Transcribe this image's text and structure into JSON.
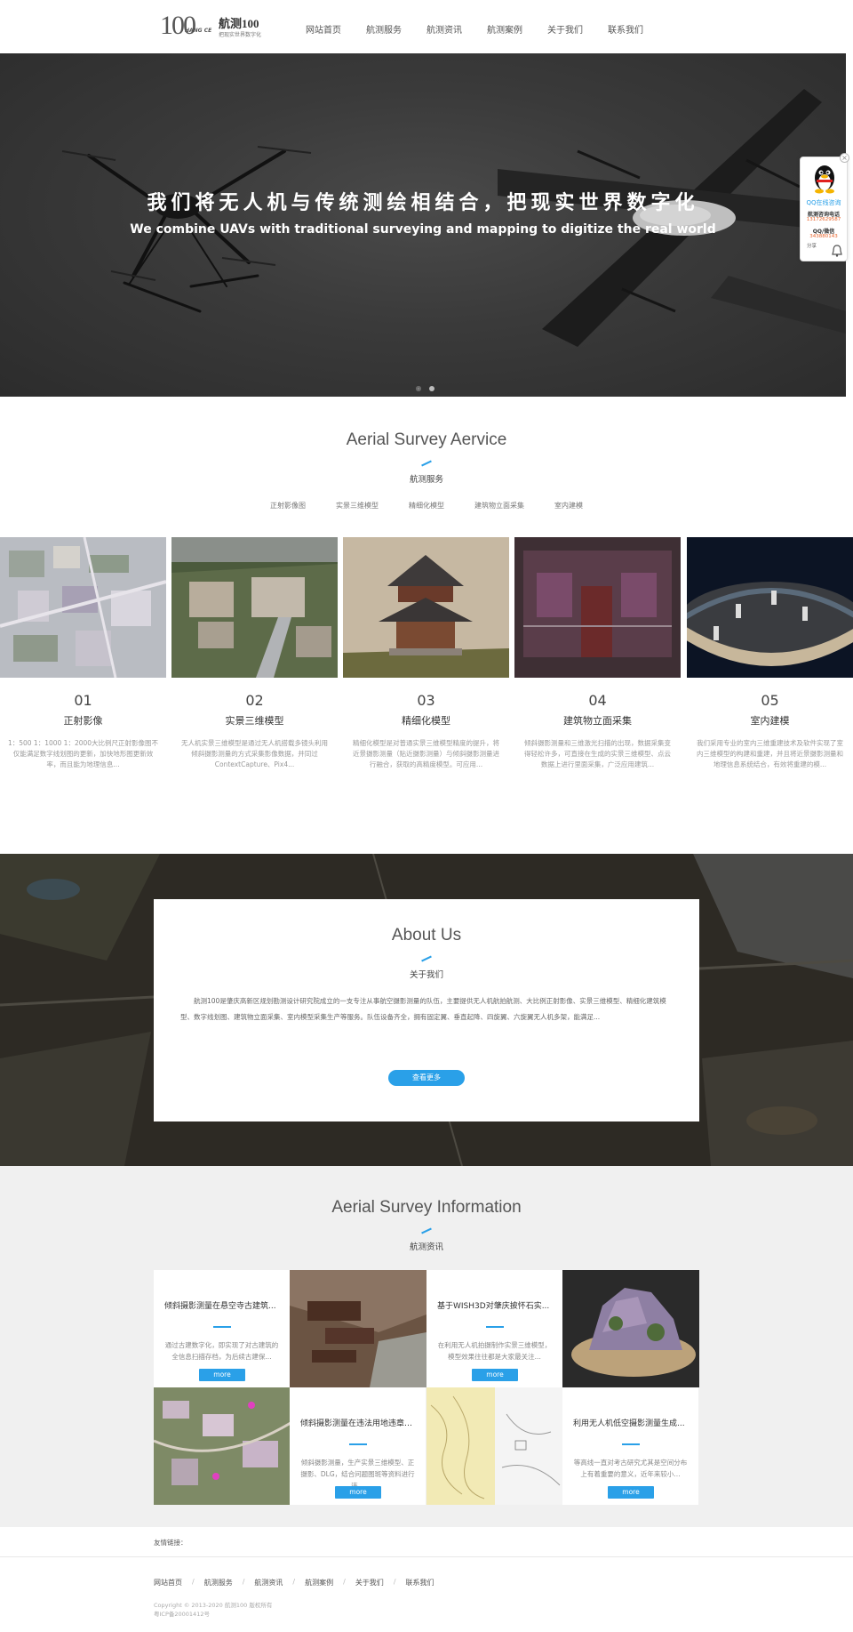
{
  "header": {
    "logo": {
      "number": "100",
      "mark": "HANG CE",
      "name": "航测100",
      "slogan": "把现实世界数字化"
    },
    "nav": [
      "网站首页",
      "航测服务",
      "航测资讯",
      "航测案例",
      "关于我们",
      "联系我们"
    ]
  },
  "banner": {
    "title": "我们将无人机与传统测绘相结合，把现实世界数字化",
    "subtitle": "We combine UAVs with traditional surveying and mapping to digitize the real world"
  },
  "qq_widget": {
    "close": "×",
    "online": "QQ在线咨询",
    "phone_label": "航测咨询电话",
    "phone": "13172629587",
    "qq_label": "QQ/微信",
    "qq": "343880143",
    "share": "分享",
    "icons": [
      "penguin-icon",
      "bell-icon"
    ]
  },
  "services": {
    "title": "Aerial Survey Aervice",
    "subtitle": "航测服务",
    "tabs": [
      "正射影像图",
      "实景三维模型",
      "精细化模型",
      "建筑物立面采集",
      "室内建模"
    ],
    "cards": [
      {
        "num": "01",
        "title": "正射影像",
        "desc": "1：500 1：1000 1：2000大比例尺正射影像图不仅能满足数字线划图的更新，加快地形图更新效率，而且能为地理信息..."
      },
      {
        "num": "02",
        "title": "实景三维模型",
        "desc": "无人机实景三维模型是通过无人机搭载多镜头利用倾斜摄影测量的方式采集影像数据，并同过ContextCapture、Pix4..."
      },
      {
        "num": "03",
        "title": "精细化模型",
        "desc": "精细化模型是对普通实景三维模型精度的提升，将近景摄影测量（贴近摄影测量）与倾斜摄影测量进行融合，获取的高精度模型。可应用..."
      },
      {
        "num": "04",
        "title": "建筑物立面采集",
        "desc": "倾斜摄影测量和三维激光扫描的出现，数据采集变得轻松许多，可直接在生成的实景三维模型、点云数据上进行里面采集，广泛应用建筑..."
      },
      {
        "num": "05",
        "title": "室内建模",
        "desc": "我们采用专业的室内三维重建技术及软件实现了室内三维模型的构建和重建，并且将近景摄影测量和地理信息系统结合，有效将重建的模..."
      }
    ]
  },
  "about": {
    "title": "About Us",
    "subtitle": "关于我们",
    "text": "航测100是肇庆高新区规划勘测设计研究院成立的一支专注从事航空摄影测量的队伍，主要提供无人机航拍航测、大比例正射影像、实景三维模型、精细化建筑模型、数字线划图、建筑物立面采集、室内模型采集生产等服务。队伍设备齐全，拥有固定翼、垂直起降、四旋翼、六旋翼无人机多架，能满足...",
    "button": "查看更多"
  },
  "info": {
    "title": "Aerial Survey Information",
    "subtitle": "航测资讯",
    "articles": [
      {
        "title": "倾斜摄影测量在悬空寺古建筑...",
        "excerpt": "通过古建数字化，即实现了对古建筑的全信息扫描存档，为后续古建保...",
        "button": "more"
      },
      {
        "title": "基于WISH3D对肇庆披怀石实...",
        "excerpt": "在利用无人机拍摄制作实景三维模型，模型效果往往都是大家最关注...",
        "button": "more"
      },
      {
        "title": "倾斜摄影测量在违法用地违章建...",
        "excerpt": "倾斜摄影测量，生产实景三维模型、正摄影、DLG，结合问题图斑等资料进行违...",
        "button": "more"
      },
      {
        "title": "利用无人机低空摄影测量生成...",
        "excerpt": "等高线一直对考古研究尤其是空间分布上有着重要的意义，近年来较小...",
        "button": "more"
      }
    ]
  },
  "friend_links": {
    "label": "友情链接："
  },
  "footer": {
    "nav": [
      "网站首页",
      "航测服务",
      "航测资讯",
      "航测案例",
      "关于我们",
      "联系我们"
    ],
    "separator": "/",
    "copyright": "Copyright © 2013-2020 航测100 版权所有",
    "icp": "粤ICP备20001412号"
  }
}
